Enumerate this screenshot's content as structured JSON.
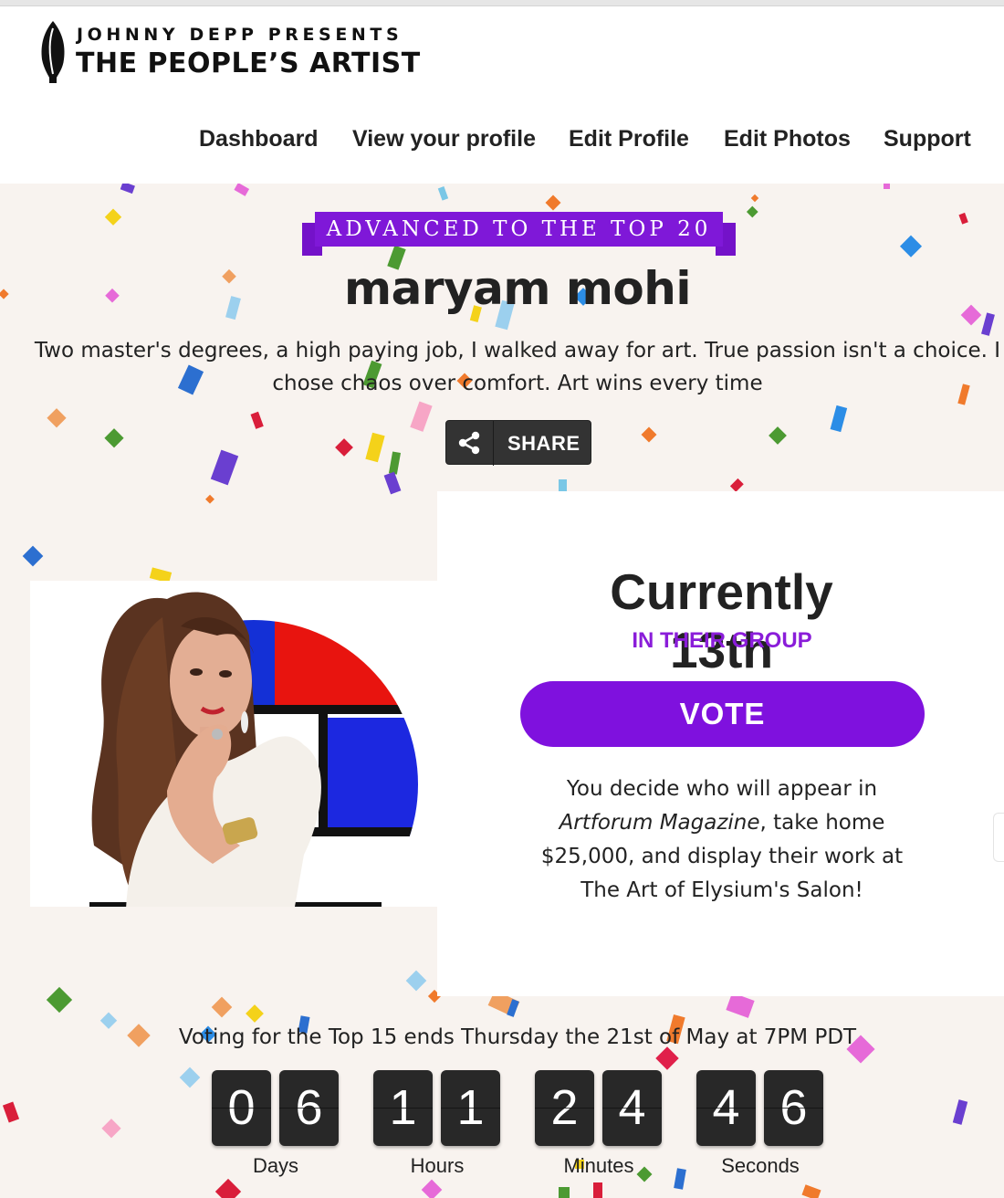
{
  "brand": {
    "presenter": "JOHNNY DEPP PRESENTS",
    "name": "THE PEOPLE’S ARTIST"
  },
  "nav": {
    "items": [
      {
        "label": "Dashboard"
      },
      {
        "label": "View your profile"
      },
      {
        "label": "Edit Profile"
      },
      {
        "label": "Edit Photos"
      },
      {
        "label": "Support"
      }
    ]
  },
  "profile": {
    "badge": "ADVANCED TO THE TOP 20",
    "name": "maryam mohi",
    "bio_line1": "Two master's degrees, a high paying job, I walked away for art. True passion isn't a choice. I",
    "bio_line2": "chose chaos over comfort. Art wins every time",
    "share_label": "SHARE"
  },
  "ranking": {
    "title": "Currently 13th",
    "subtitle": "IN THEIR GROUP",
    "vote_label": "VOTE",
    "desc_line1": "You decide who will appear in",
    "desc_italic": "Artforum Magazine",
    "desc_line2_rest": ", take home",
    "desc_line3": "$25,000, and display their work at",
    "desc_line4": "The Art of Elysium's Salon!"
  },
  "countdown": {
    "note": "Voting for the Top 15 ends Thursday the 21st of May at 7PM PDT",
    "units": [
      {
        "label": "Days",
        "digits": [
          "0",
          "6"
        ]
      },
      {
        "label": "Hours",
        "digits": [
          "1",
          "1"
        ]
      },
      {
        "label": "Minutes",
        "digits": [
          "2",
          "4"
        ]
      },
      {
        "label": "Seconds",
        "digits": [
          "4",
          "6"
        ]
      }
    ]
  },
  "colors": {
    "accent_purple": "#7f11de",
    "subtitle_purple": "#8a1dd9",
    "page_background": "#f8f3ef",
    "digit_background": "#282828"
  }
}
